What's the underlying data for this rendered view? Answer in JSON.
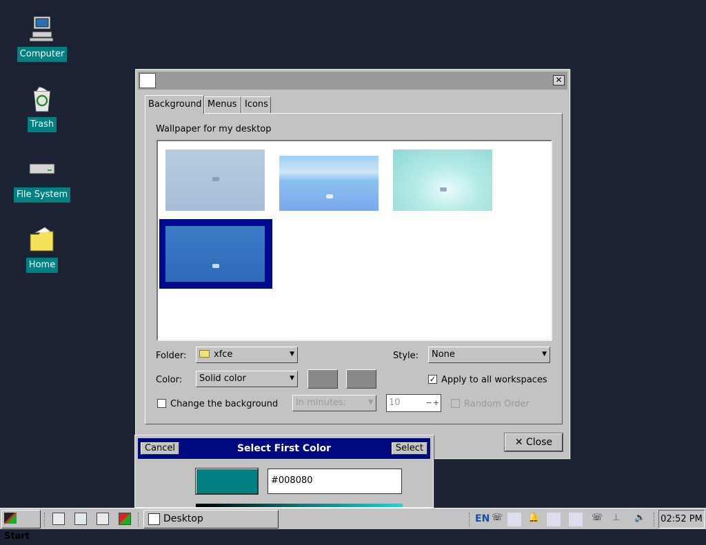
{
  "desktop": {
    "icons": [
      {
        "label": "Computer"
      },
      {
        "label": "Trash"
      },
      {
        "label": "File System"
      },
      {
        "label": "Home"
      }
    ]
  },
  "dialog": {
    "tabs": [
      "Background",
      "Menus",
      "Icons"
    ],
    "heading": "Wallpaper for my desktop",
    "folder_label": "Folder:",
    "folder_value": "xfce",
    "style_label": "Style:",
    "style_value": "None",
    "color_label": "Color:",
    "color_mode": "Solid color",
    "apply_all_label": "Apply to all workspaces",
    "apply_all_checked": true,
    "change_bg_label": "Change the background",
    "change_bg_checked": false,
    "interval_placeholder": "In minutes:",
    "interval_value": "10",
    "random_order_label": "Random Order",
    "close_label": "Close",
    "close_icon": "x-icon"
  },
  "color_dialog": {
    "title": "Select First Color",
    "cancel_label": "Cancel",
    "select_label": "Select",
    "hex_value": "#008080",
    "preview_color": "#008080"
  },
  "taskbar": {
    "start_label": "Start",
    "task_label": "Desktop",
    "lang": "EN",
    "clock": "02:52 PM"
  }
}
